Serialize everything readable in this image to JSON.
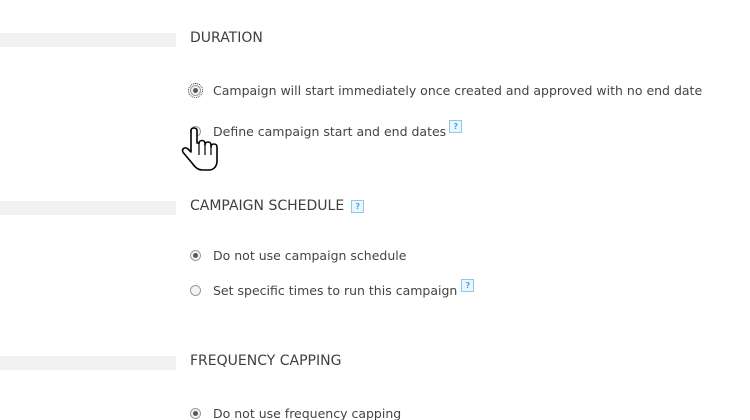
{
  "sections": {
    "duration": {
      "title": "DURATION",
      "options": [
        {
          "label": "Campaign will start immediately once created and approved with no end date",
          "checked": true
        },
        {
          "label": "Define campaign start and end dates",
          "checked": false,
          "help": "?"
        }
      ]
    },
    "schedule": {
      "title": "CAMPAIGN SCHEDULE",
      "help": "?",
      "options": [
        {
          "label": "Do not use campaign schedule",
          "checked": true
        },
        {
          "label": "Set specific times to run this campaign",
          "checked": false,
          "help": "?"
        }
      ]
    },
    "frequency": {
      "title": "FREQUENCY CAPPING",
      "options": [
        {
          "label": "Do not use frequency capping",
          "checked": true
        }
      ]
    }
  },
  "colors": {
    "help_border": "#8ec9e8",
    "help_text": "#4aa6d8",
    "section_bar": "#f1f1f1"
  },
  "cursor": "hand-pointer-icon"
}
